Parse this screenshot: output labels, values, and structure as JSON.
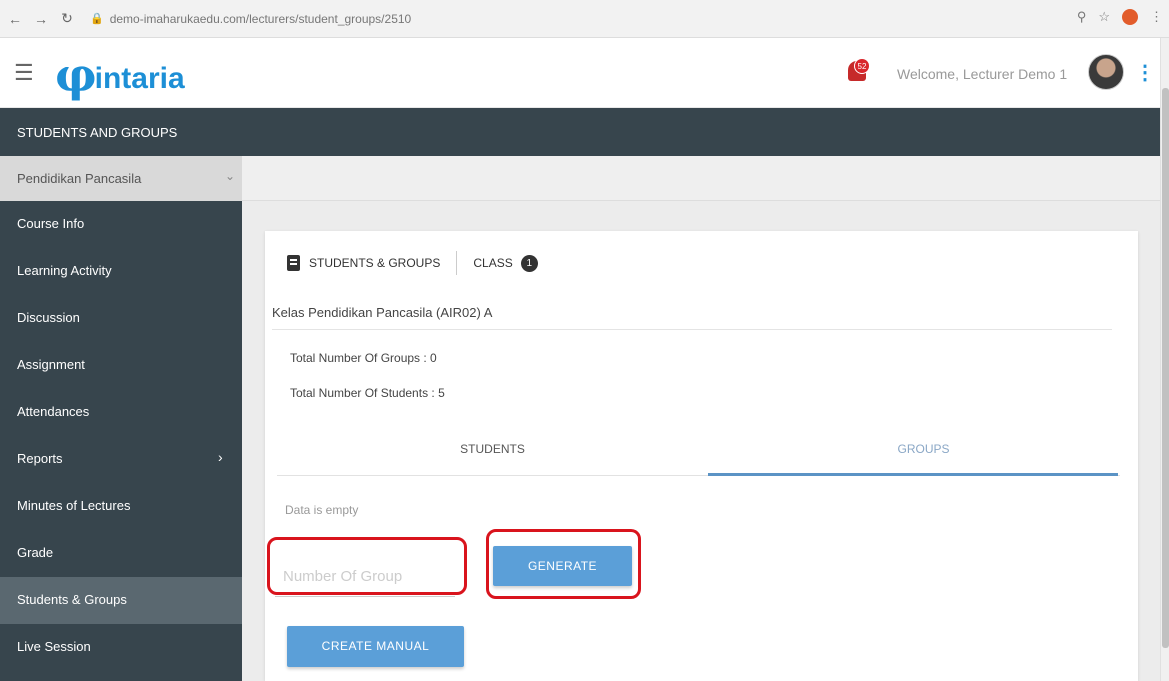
{
  "browser": {
    "url": "demo-imaharukaedu.com/lecturers/student_groups/2510",
    "back_icon": "arrow-left-icon",
    "forward_icon": "arrow-right-icon",
    "reload_icon": "reload-icon",
    "lock_icon": "lock-icon",
    "zoom_icon": "zoom-icon",
    "star_icon": "star-icon",
    "menu_icon": "kebab-icon"
  },
  "header": {
    "logo_text": "intaria",
    "notification_count": "52",
    "welcome_text": "Welcome, Lecturer Demo 1"
  },
  "section_title": "STUDENTS AND GROUPS",
  "course_selector": {
    "selected": "Pendidikan Pancasila"
  },
  "sidebar": {
    "items": [
      {
        "label": "Course Info"
      },
      {
        "label": "Learning Activity"
      },
      {
        "label": "Discussion"
      },
      {
        "label": "Assignment"
      },
      {
        "label": "Attendances"
      },
      {
        "label": "Reports"
      },
      {
        "label": "Minutes of Lectures"
      },
      {
        "label": "Grade"
      },
      {
        "label": "Students & Groups"
      },
      {
        "label": "Live Session"
      }
    ],
    "active_index": 8
  },
  "card": {
    "heading": "STUDENTS & GROUPS",
    "class_label": "CLASS",
    "class_count": "1",
    "class_name": "Kelas Pendidikan Pancasila (AIR02) A",
    "total_groups": "Total Number Of Groups : 0",
    "total_students": "Total Number Of Students : 5",
    "tabs": [
      {
        "label": "STUDENTS"
      },
      {
        "label": "GROUPS"
      }
    ],
    "active_tab": 1,
    "empty_message": "Data is empty",
    "group_input_placeholder": "Number Of Group",
    "generate_label": "GENERATE",
    "create_manual_label": "CREATE MANUAL"
  },
  "colors": {
    "dark_bar": "#37454d",
    "accent": "#5b9fd8",
    "highlight": "#d9141d",
    "brand": "#1d8fd6"
  }
}
